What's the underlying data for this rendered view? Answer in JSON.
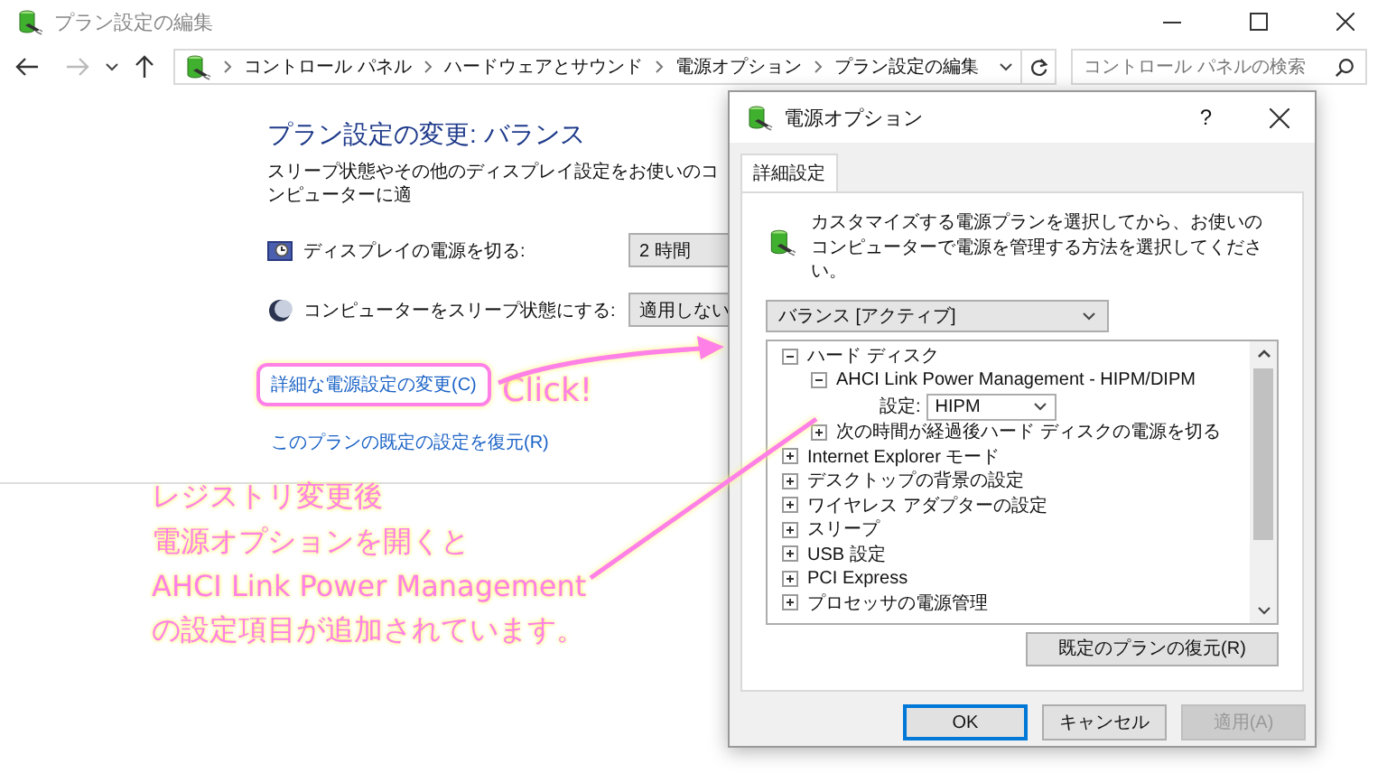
{
  "window": {
    "title": "プラン設定の編集"
  },
  "nav": {
    "breadcrumbs": [
      "コントロール パネル",
      "ハードウェアとサウンド",
      "電源オプション",
      "プラン設定の編集"
    ],
    "search": {
      "placeholder": "コントロール パネルの検索"
    }
  },
  "page": {
    "heading": "プラン設定の変更: バランス",
    "description": "スリープ状態やその他のディスプレイ設定をお使いのコンピューターに適",
    "settings": [
      {
        "kind": "display",
        "label": "ディスプレイの電源を切る:",
        "value": "2 時間"
      },
      {
        "kind": "sleep",
        "label": "コンピューターをスリープ状態にする:",
        "value": "適用しない"
      }
    ],
    "links": [
      {
        "label": "詳細な電源設定の変更(C)",
        "highlighted": true
      },
      {
        "label": "このプランの既定の設定を復元(R)",
        "highlighted": false
      }
    ]
  },
  "dialog": {
    "title": "電源オプション",
    "help": "?",
    "tabs": [
      {
        "label": "詳細設定",
        "selected": true
      }
    ],
    "description": "カスタマイズする電源プランを選択してから、お使いのコンピューターで電源を管理する方法を選択してください。",
    "plan": "バランス [アクティブ]",
    "tree": [
      {
        "label": "ハード ディスク",
        "expanded": true,
        "children": [
          {
            "label": "AHCI Link Power Management - HIPM/DIPM",
            "expanded": true,
            "setting": {
              "label": "設定:",
              "value": "HIPM"
            }
          },
          {
            "label": "次の時間が経過後ハード ディスクの電源を切る",
            "expanded": false
          }
        ]
      },
      {
        "label": "Internet Explorer モード",
        "expanded": false
      },
      {
        "label": "デスクトップの背景の設定",
        "expanded": false
      },
      {
        "label": "ワイヤレス アダプターの設定",
        "expanded": false
      },
      {
        "label": "スリープ",
        "expanded": false
      },
      {
        "label": "USB 設定",
        "expanded": false
      },
      {
        "label": "PCI Express",
        "expanded": false
      },
      {
        "label": "プロセッサの電源管理",
        "expanded": false
      }
    ],
    "restore_button": "既定のプランの復元(R)",
    "buttons": [
      {
        "label": "OK",
        "default": true,
        "disabled": false
      },
      {
        "label": "キャンセル",
        "default": false,
        "disabled": false
      },
      {
        "label": "適用(A)",
        "default": false,
        "disabled": true
      }
    ]
  },
  "annotations": {
    "click": "Click!",
    "note": [
      "レジストリ変更後",
      "電源オプションを開くと",
      "AHCI Link Power Management",
      "の設定項目が追加されています。"
    ]
  }
}
